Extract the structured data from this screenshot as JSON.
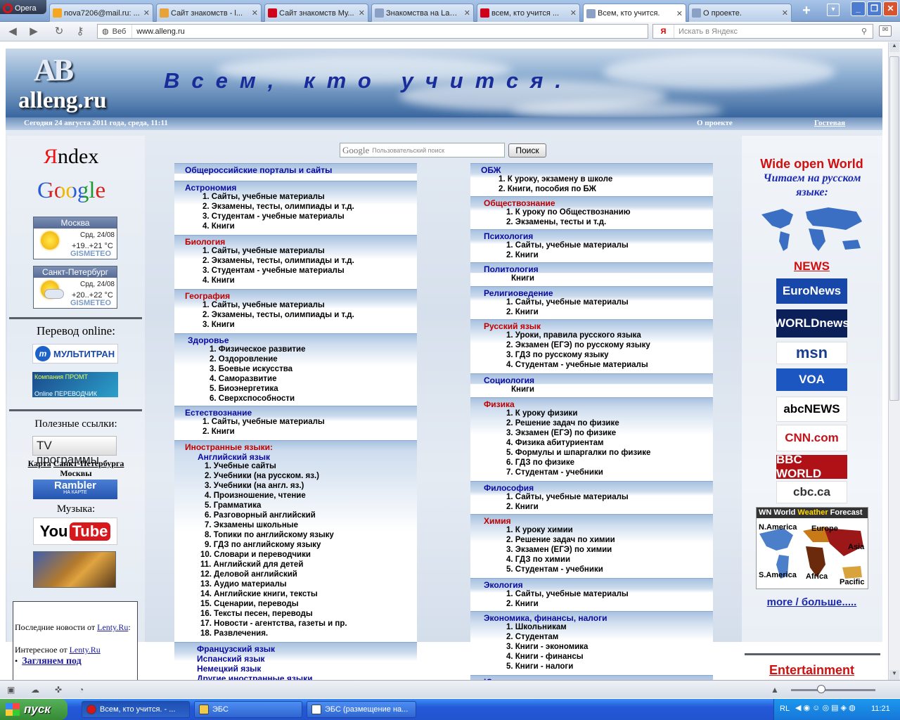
{
  "browser": {
    "opera_label": "Opera",
    "tabs": [
      {
        "title": "nova7206@mail.ru: ...",
        "fav": "#f5a623"
      },
      {
        "title": "Сайт знакомств - l...",
        "fav": "#e8a23a"
      },
      {
        "title": "Сайт знакомств Му...",
        "fav": "#d0021b"
      },
      {
        "title": "Знакомства на Lam...",
        "fav": "#8aa0c4"
      },
      {
        "title": "всем, кто учится ...",
        "fav": "#d0021b"
      },
      {
        "title": "Всем, кто учится.",
        "fav": "#8aa0c4"
      },
      {
        "title": "О проекте.",
        "fav": "#8aa0c4"
      }
    ],
    "address_label": "Веб",
    "url": "www.alleng.ru",
    "search_placeholder": "Искать в Яндекс",
    "search_engine_badge": "Я"
  },
  "header": {
    "logo_ab": "AB",
    "logo_site": "alleng.ru",
    "slogan": "Всем, кто учится.",
    "date": "Сегодня 24 августа 2011 года, среда, 11:11",
    "about": "О проекте",
    "guestbook": "Гостевая"
  },
  "left": {
    "yandex_y": "Я",
    "yandex_rest": "ndex",
    "google": "Google",
    "weather": [
      {
        "city": "Москва",
        "date": "Срд, 24/08",
        "temp": "+19..+21 °C",
        "brand": "GISMETEO"
      },
      {
        "city": "Санкт-Петербург",
        "date": "Срд, 24/08",
        "temp": "+20..+22 °C",
        "brand": "GISMETEO"
      }
    ],
    "translate_heading": "Перевод online:",
    "multitran": "МУЛЬТИТРАН",
    "promt_line1": "Компания ПРОМТ",
    "promt_line2": "Online ПЕРЕВОДЧИК",
    "useful_heading": "Полезные ссылки:",
    "tv": "TV программы",
    "map_links_1": "Карта",
    "map_links_2": "Санкт-Петербурга",
    "map_links_3": "Москвы",
    "rambler": "Rambler",
    "rambler_sub": "НА КАРТЕ",
    "music_heading": "Музыка:",
    "youtube_you": "You",
    "youtube_tube": "Tube",
    "news_label": "Последние новости от",
    "news_source": "Lenty.Ru",
    "news_colon": ":",
    "interesting": "Интересное от",
    "interesting_source": "Lenty.Ru",
    "bullet": "Заглянем под"
  },
  "google_search": {
    "placeholder": "Пользовательский поиск",
    "button": "Поиск",
    "brand": "Google"
  },
  "col_left": [
    {
      "head": "Общероссийские порталы и сайты",
      "color": "blue",
      "items": []
    },
    {
      "head": "Астрономия",
      "color": "blue",
      "items": [
        "1. Сайты, учебные материалы",
        "2. Экзамены, тесты, олимпиады и т.д.",
        "3. Студентам - учебные материалы",
        "4. Книги"
      ]
    },
    {
      "head": "Биология",
      "color": "red",
      "items": [
        "1. Сайты, учебные материалы",
        "2. Экзамены, тесты, олимпиады и т.д.",
        "3. Студентам - учебные материалы",
        "4. Книги"
      ]
    },
    {
      "head": "География",
      "color": "red",
      "items": [
        "1. Сайты, учебные материалы",
        "2. Экзамены, тесты, олимпиады и т.д.",
        "3. Книги"
      ]
    },
    {
      "head": "Здоровье",
      "color": "blue",
      "items": [
        "1. Физическое развитие",
        "2. Оздоровление",
        "3. Боевые искусства",
        "4. Саморазвитие",
        "5. Биоэнергетика",
        "6. Сверхспособности"
      ]
    },
    {
      "head": "Естествознание",
      "color": "blue",
      "items": [
        "1. Сайты, учебные материалы",
        "2. Книги"
      ]
    },
    {
      "head": "Иностранные языки:",
      "color": "red",
      "sub": "Английский язык",
      "items": [
        "1. Учебные сайты",
        "2. Учебники (на русском. яз.)",
        "3. Учебники (на англ. яз.)",
        "4. Произношение, чтение",
        "5. Грамматика",
        "6. Разговорный английский",
        "7. Экзамены школьные",
        "8. Топики по английскому языку",
        "9. ГДЗ по английскому языку",
        "10. Словари и переводчики",
        "11. Английский для детей",
        "12. Деловой английский",
        "13. Аудио материалы",
        "14. Английские книги, тексты",
        "15. Сценарии, переводы",
        "16. Тексты песен, переводы",
        "17. Новости - агентства, газеты и пр.",
        "18. Развлечения."
      ]
    },
    {
      "head": "",
      "color": "blue",
      "langs": [
        "Французский язык",
        "Испанский язык",
        "Немецкий язык",
        "Другие иностранные языки"
      ],
      "items": []
    }
  ],
  "col_right": [
    {
      "head": "ОБЖ",
      "color": "blue",
      "items": [
        "1. К уроку, экзамену в школе",
        "2. Книги, пособия по БЖ"
      ]
    },
    {
      "head": "Обществознание",
      "color": "red",
      "items": [
        "1. К уроку по Обществознанию",
        "2. Экзамены, тесты и т.д."
      ]
    },
    {
      "head": "Психология",
      "color": "blue",
      "items": [
        "1. Сайты, учебные материалы",
        "2. Книги"
      ]
    },
    {
      "head": "Политология",
      "color": "blue",
      "items": [
        "Книги"
      ]
    },
    {
      "head": "Религиоведение",
      "color": "blue",
      "items": [
        "1. Сайты, учебные материалы",
        "2. Книги"
      ]
    },
    {
      "head": "Русский язык",
      "color": "red",
      "items": [
        "1. Уроки, правила русского языка",
        "2. Экзамен (ЕГЭ) по русскому языку",
        "3. ГДЗ по русскому языку",
        "4. Студентам - учебные материалы"
      ]
    },
    {
      "head": "Социология",
      "color": "blue",
      "items": [
        "Книги"
      ]
    },
    {
      "head": "Физика",
      "color": "red",
      "items": [
        "1. К уроку физики",
        "2. Решение задач по физике",
        "3. Экзамен (ЕГЭ) по физике",
        "4. Физика абитуриентам",
        "5. Формулы и шпаргалки по физике",
        "6. ГДЗ по физике",
        "7. Студентам - учебники"
      ]
    },
    {
      "head": "Философия",
      "color": "blue",
      "items": [
        "1. Сайты, учебные материалы",
        "2. Книги"
      ]
    },
    {
      "head": "Химия",
      "color": "red",
      "items": [
        "1. К уроку химии",
        "2. Решение задач по химии",
        "3. Экзамен (ЕГЭ) по химии",
        "4. ГДЗ по химии",
        "5. Студентам - учебники"
      ]
    },
    {
      "head": "Экология",
      "color": "blue",
      "items": [
        "1. Сайты, учебные материалы",
        "2. Книги"
      ]
    },
    {
      "head": "Экономика, финансы, налоги",
      "color": "blue",
      "items": [
        "1. Школьникам",
        "2. Студентам",
        "3. Книги - экономика",
        "4. Книги - финансы",
        "5. Книги - налоги"
      ]
    },
    {
      "head": "Юриспруденция",
      "color": "blue",
      "items": []
    }
  ],
  "right": {
    "wow": "Wide open World",
    "read_ru": "Читаем на русском языке:",
    "news": "NEWS",
    "logos": [
      {
        "text": "EuroNews",
        "bg": "#1747a8",
        "fg": "#ffffff"
      },
      {
        "text": "WORLDnews",
        "bg": "#0b1f59",
        "fg": "#ffffff"
      },
      {
        "text": "msn",
        "bg": "#ffffff",
        "fg": "#1a3d8f"
      },
      {
        "text": "VOA",
        "bg": "#1c56c0",
        "fg": "#ffffff"
      },
      {
        "text": "abcNEWS",
        "bg": "#ffffff",
        "fg": "#000000"
      },
      {
        "text": "CNN.com",
        "bg": "#ffffff",
        "fg": "#c4121a"
      },
      {
        "text": "BBC WORLD",
        "bg": "#b01116",
        "fg": "#ffffff"
      },
      {
        "text": "cbc.ca",
        "bg": "#ffffff",
        "fg": "#333333"
      }
    ],
    "weather_map_title_wn": "WN World ",
    "weather_map_title_w": "Weather",
    "weather_map_title_f": " Forecast",
    "regions": [
      "N.America",
      "Europe",
      "Asia",
      "S.America",
      "Africa",
      "Pacific"
    ],
    "more": "more / больше.....",
    "entertainment": "Entertainment"
  },
  "taskbar": {
    "start": "пуск",
    "tasks": [
      "Всем, кто учится. - ...",
      "ЭБС",
      "ЭБС (размещение на..."
    ],
    "lang": "RL",
    "clock": "11:21"
  }
}
